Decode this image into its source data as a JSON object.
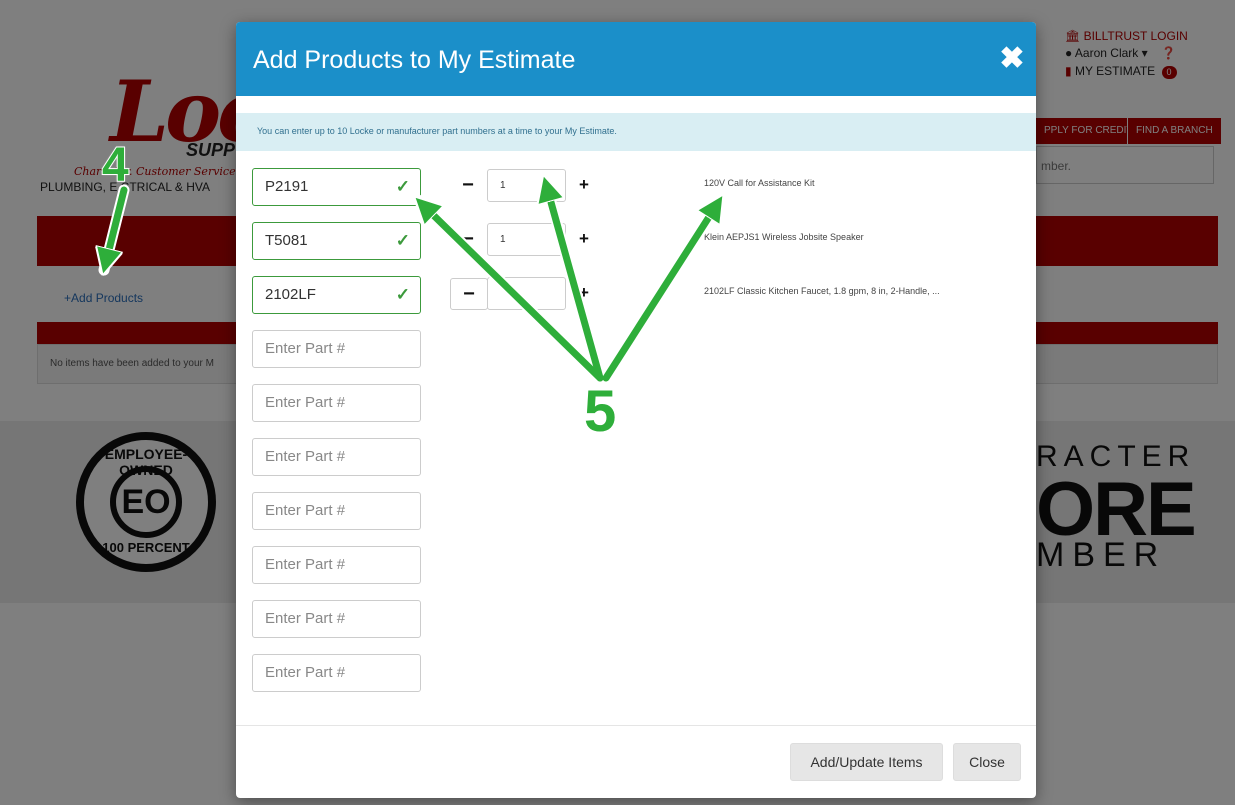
{
  "background": {
    "logo_text": "Lock",
    "logo_sub": "SUPP",
    "tagline": "Character. Customer Service. E",
    "category_line": "PLUMBING, E     CTRICAL & HVA",
    "account": {
      "billtrust_login": "BILLTRUST LOGIN",
      "user_name": "Aaron Clark",
      "my_estimate": "MY ESTIMATE",
      "estimate_count": "0"
    },
    "nav": {
      "apply_credit": "PPLY FOR CREDIT",
      "find_branch": "FIND A BRANCH"
    },
    "search_placeholder_visible": "mber.",
    "add_products_link": "Add Products",
    "empty_message": "No items have been added to your M",
    "footer": {
      "eo_top": "EMPLOYEE-OWNED",
      "eo_center": "EO",
      "eo_bottom": "100 PERCENT",
      "character_top": "RACTER",
      "character_mid": "ORE",
      "character_bottom": "MBER"
    }
  },
  "modal": {
    "title": "Add Products to My Estimate",
    "close_icon": "close-x-icon",
    "info_text": "You can enter up to 10 Locke or manufacturer part numbers at a time to your My Estimate.",
    "part_placeholder": "Enter Part #",
    "rows": [
      {
        "part": "P2191",
        "valid": true,
        "qty": "1",
        "desc": "120V Call for Assistance Kit"
      },
      {
        "part": "T5081",
        "valid": true,
        "qty": "1",
        "desc": "Klein AEPJS1 Wireless Jobsite Speaker"
      },
      {
        "part": "2102LF",
        "valid": true,
        "qty": "",
        "desc": "2102LF Classic Kitchen Faucet, 1.8 gpm, 8 in, 2-Handle, ..."
      },
      {
        "part": "",
        "valid": false
      },
      {
        "part": "",
        "valid": false
      },
      {
        "part": "",
        "valid": false
      },
      {
        "part": "",
        "valid": false
      },
      {
        "part": "",
        "valid": false
      },
      {
        "part": "",
        "valid": false
      },
      {
        "part": "",
        "valid": false
      }
    ],
    "footer": {
      "add_update_label": "Add/Update Items",
      "close_label": "Close"
    }
  },
  "annotations": {
    "step4": "4",
    "step5": "5",
    "arrow_color": "#2eae3a"
  }
}
